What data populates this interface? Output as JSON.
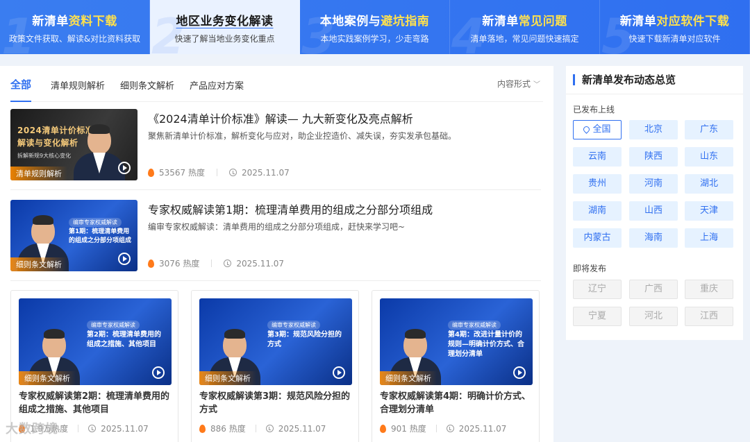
{
  "topnav": [
    {
      "num": "1",
      "title_a": "新清单",
      "title_b": "资料下载",
      "sub": "政策文件获取、解读&对比资料获取"
    },
    {
      "num": "2",
      "title_a": "地区业务变化解读",
      "title_b": "",
      "sub": "快速了解当地业务变化重点"
    },
    {
      "num": "3",
      "title_a": "本地案例与",
      "title_b": "避坑指南",
      "sub": "本地实践案例学习，少走弯路"
    },
    {
      "num": "4",
      "title_a": "新清单",
      "title_b": "常见问题",
      "sub": "清单落地，常见问题快速搞定"
    },
    {
      "num": "5",
      "title_a": "新清单",
      "title_b": "对应软件下载",
      "sub": "快速下载新清单对应软件"
    }
  ],
  "filters": {
    "tabs": [
      "全部",
      "清单规则解析",
      "细则条文解析",
      "产品应对方案"
    ],
    "form_label": "内容形式"
  },
  "articles": [
    {
      "thumb_title_1": "2024清单计价标准",
      "thumb_title_2": "解读与变化解析",
      "thumb_sub": "拆解新规9大核心变化",
      "tag": "清单规则解析",
      "title": "《2024清单计价标准》解读— 九大新变化及亮点解析",
      "desc": "聚焦新清单计价标准，解析变化与应对，助企业控造价、减失误，夯实发承包基础。",
      "heat": "53567 热度",
      "date": "2025.11.07"
    },
    {
      "thumb_head": "编审专家权威解读",
      "thumb_text": "第1期：梳理清单费用的组成之分部分项组成",
      "tag": "细则条文解析",
      "title": "专家权威解读第1期：梳理清单费用的组成之分部分项组成",
      "desc": "编审专家权威解读：清单费用的组成之分部分项组成，赶快来学习吧~",
      "heat": "3076 热度",
      "date": "2025.11.07"
    }
  ],
  "cards": [
    {
      "thumb_head": "编审专家权威解读",
      "thumb_text": "第2期：梳理清单费用的组成之措施、其他项目",
      "tag": "细则条文解析",
      "title": "专家权威解读第2期：梳理清单费用的组成之措施、其他项目",
      "heat": "1.9万热度",
      "date": "2025.11.07"
    },
    {
      "thumb_head": "编审专家权威解读",
      "thumb_text": "第3期：规范风险分担的方式",
      "tag": "细则条文解析",
      "title": "专家权威解读第3期：规范风险分担的方式",
      "heat": "886 热度",
      "date": "2025.11.07"
    },
    {
      "thumb_head": "编审专家权威解读",
      "thumb_text": "第4期：改进计量计价的规则—明确计价方式、合理划分清单",
      "tag": "细则条文解析",
      "title": "专家权威解读第4期：明确计价方式、合理划分清单",
      "heat": "901 热度",
      "date": "2025.11.07"
    }
  ],
  "side": {
    "title": "新清单发布动态总览",
    "published_label": "已发布上线",
    "published": [
      "全国",
      "北京",
      "广东",
      "云南",
      "陕西",
      "山东",
      "贵州",
      "河南",
      "湖北",
      "湖南",
      "山西",
      "天津",
      "内蒙古",
      "海南",
      "上海"
    ],
    "upcoming_label": "即将发布",
    "upcoming": [
      "辽宁",
      "广西",
      "重庆",
      "宁夏",
      "河北",
      "江西"
    ]
  },
  "watermark": "大数跨境"
}
